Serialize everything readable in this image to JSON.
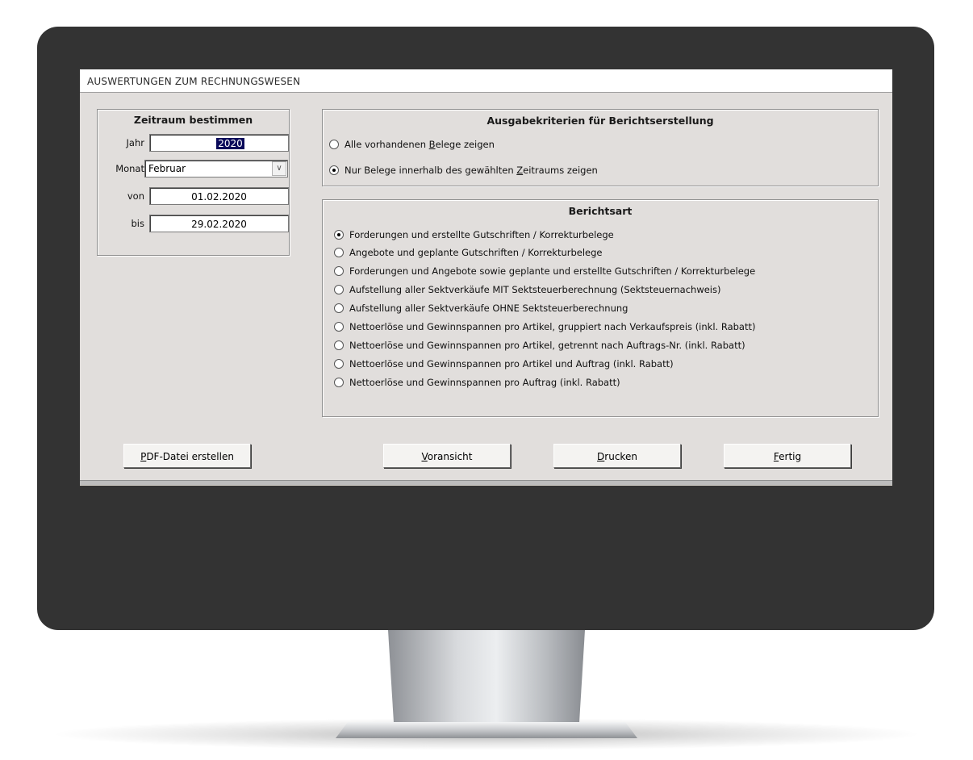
{
  "window": {
    "title": "AUSWERTUNGEN ZUM RECHNUNGSWESEN"
  },
  "zeitraum": {
    "title": "Zeitraum bestimmen",
    "jahr_label": "Jahr",
    "jahr_value": "2020",
    "monat_label": "Monat",
    "monat_value": "Februar",
    "von_label": "von",
    "von_value": "01.02.2020",
    "bis_label": "bis",
    "bis_value": "29.02.2020"
  },
  "ausgabe": {
    "title": "Ausgabekriterien für Berichtserstellung",
    "options": [
      {
        "pre": "Alle vorhandenen ",
        "ul": "B",
        "post": "elege zeigen",
        "selected": false
      },
      {
        "pre": "Nur Belege innerhalb des gewählten ",
        "ul": "Z",
        "post": "eitraums zeigen",
        "selected": true
      }
    ]
  },
  "berichtsart": {
    "title": "Berichtsart",
    "options": [
      {
        "label": "Forderungen und erstellte Gutschriften / Korrekturbelege",
        "selected": true
      },
      {
        "label": "Angebote und geplante Gutschriften / Korrekturbelege",
        "selected": false
      },
      {
        "label": "Forderungen und Angebote sowie geplante und erstellte Gutschriften / Korrekturbelege",
        "selected": false
      },
      {
        "label": "Aufstellung aller Sektverkäufe MIT Sektsteuerberechnung (Sektsteuernachweis)",
        "selected": false
      },
      {
        "label": "Aufstellung aller Sektverkäufe OHNE Sektsteuerberechnung",
        "selected": false
      },
      {
        "label": "Nettoerlöse und Gewinnspannen pro Artikel, gruppiert nach Verkaufspreis (inkl. Rabatt)",
        "selected": false
      },
      {
        "label": "Nettoerlöse und Gewinnspannen pro Artikel, getrennt nach Auftrags-Nr. (inkl. Rabatt)",
        "selected": false
      },
      {
        "label": "Nettoerlöse und Gewinnspannen pro Artikel und Auftrag (inkl. Rabatt)",
        "selected": false
      },
      {
        "label": "Nettoerlöse und Gewinnspannen pro Auftrag (inkl. Rabatt)",
        "selected": false
      }
    ]
  },
  "buttons": {
    "pdf": {
      "ul": "P",
      "rest": "DF-Datei erstellen"
    },
    "voransicht": {
      "ul": "V",
      "rest": "oransicht"
    },
    "drucken": {
      "ul": "D",
      "rest": "rucken"
    },
    "fertig": {
      "ul": "F",
      "rest": "ertig"
    }
  },
  "icons": {
    "combo_arrow": "chevron-down-icon"
  }
}
